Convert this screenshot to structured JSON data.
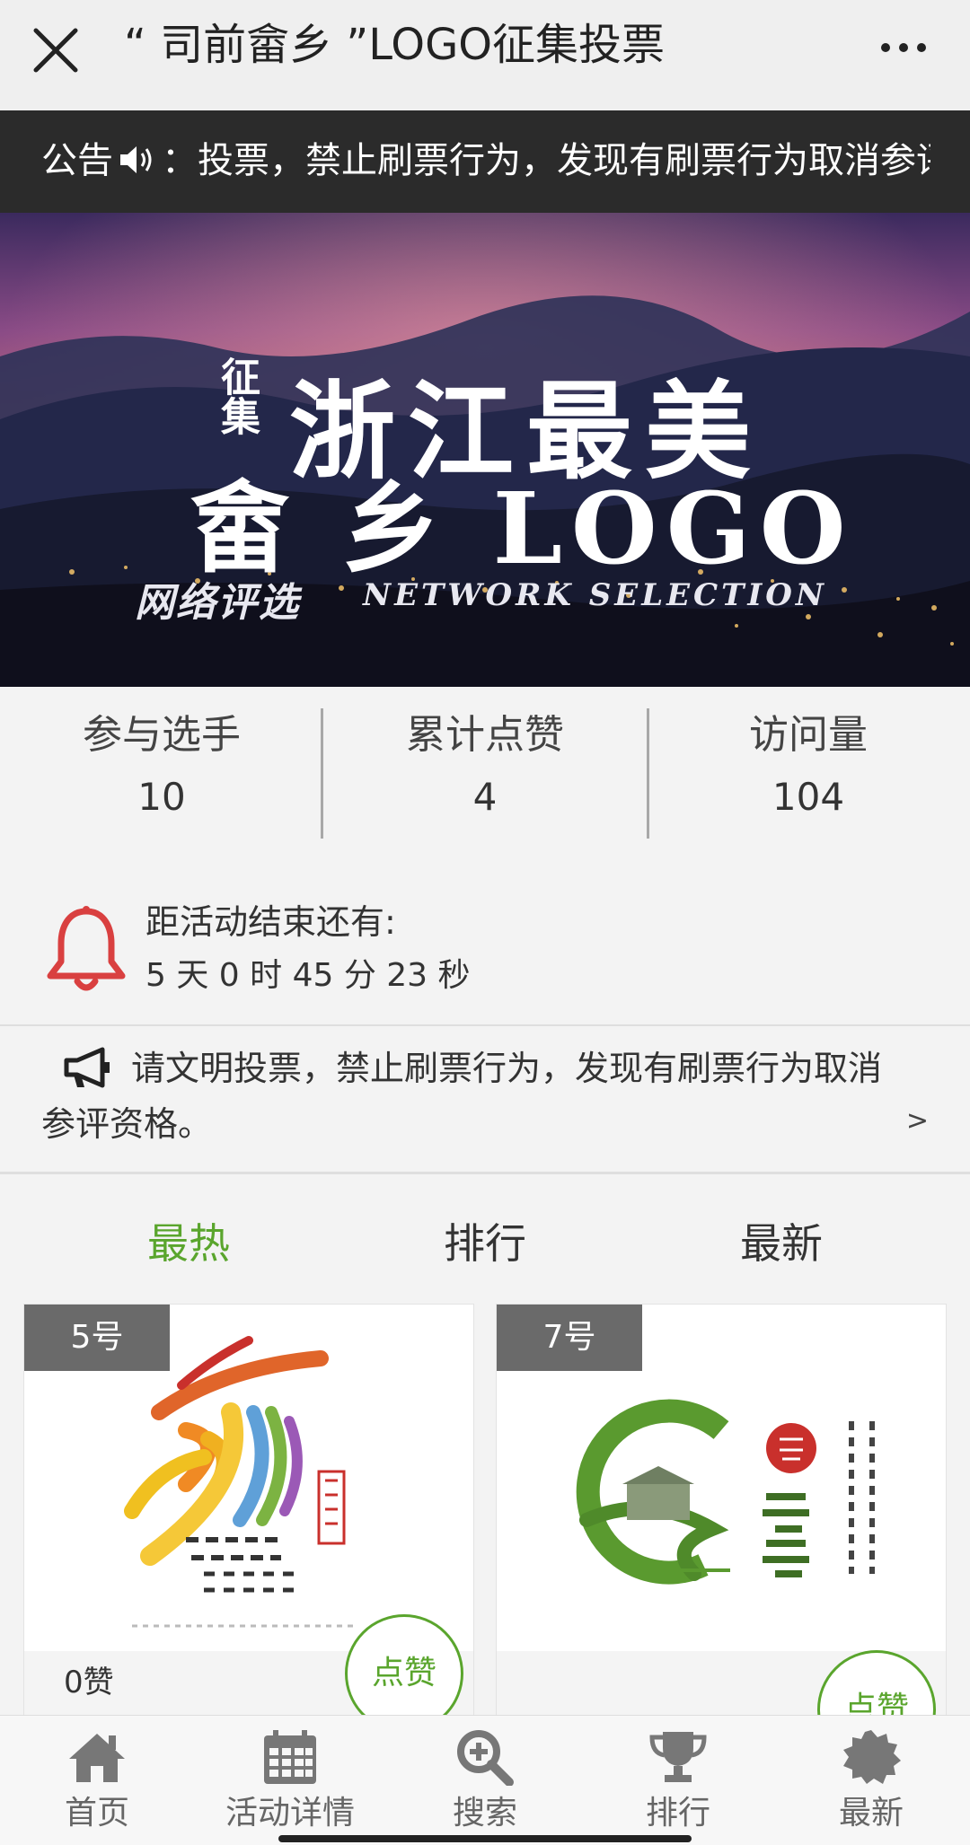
{
  "header": {
    "title": "“ 司前畲乡 ”LOGO征集投票",
    "close_icon": "close-icon",
    "more_icon": "more-icon"
  },
  "notice_bar": {
    "prefix": "公告",
    "speaker_icon": "speaker-icon",
    "text": "：投票，禁止刷票行为，发现有刷票行为取消参评资格。"
  },
  "banner": {
    "line_small": "征集",
    "line1": "浙江最美",
    "line2": "畲 乡 LOGO",
    "line3_cn": "网络评选",
    "line3_en": "NETWORK SELECTION"
  },
  "stats": [
    {
      "label": "参与选手",
      "value": "10"
    },
    {
      "label": "累计点赞",
      "value": "4"
    },
    {
      "label": "访问量",
      "value": "104"
    }
  ],
  "countdown": {
    "icon": "bell-icon",
    "label": "距活动结束还有:",
    "time": "5 天 0 时 45 分 23 秒"
  },
  "announcement": {
    "icon": "megaphone-icon",
    "text": "请文明投票，禁止刷票行为，发现有刷票行为取消参评资格。",
    "arrow": ">"
  },
  "tabs": [
    {
      "label": "最热",
      "active": true
    },
    {
      "label": "排行",
      "active": false
    },
    {
      "label": "最新",
      "active": false
    }
  ],
  "cards": [
    {
      "number": "5号",
      "likes": "0赞",
      "button": "点赞"
    },
    {
      "number": "7号",
      "likes": "",
      "button": "点赞"
    }
  ],
  "bottom_nav": [
    {
      "label": "首页",
      "icon": "home-icon"
    },
    {
      "label": "活动详情",
      "icon": "calendar-icon"
    },
    {
      "label": "搜索",
      "icon": "search-plus-icon"
    },
    {
      "label": "排行",
      "icon": "trophy-icon"
    },
    {
      "label": "最新",
      "icon": "badge-icon"
    }
  ],
  "colors": {
    "accent": "#5aa52d",
    "notice_bg": "#2b2b2b",
    "bell": "#d94040"
  }
}
